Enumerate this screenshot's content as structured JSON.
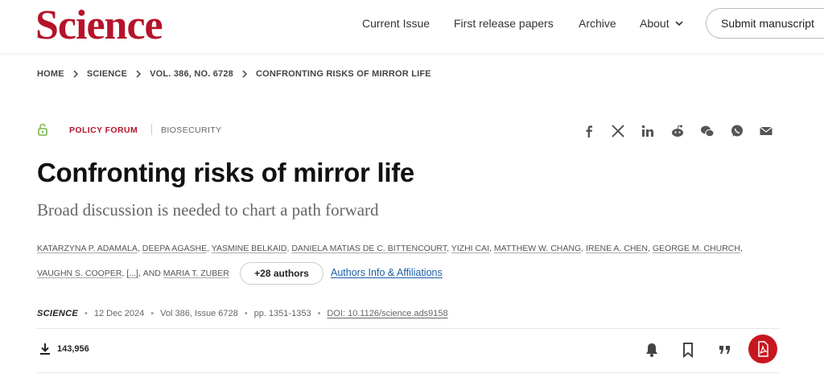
{
  "header": {
    "logo": "Science",
    "nav": [
      {
        "label": "Current Issue"
      },
      {
        "label": "First release papers"
      },
      {
        "label": "Archive"
      },
      {
        "label": "About"
      }
    ],
    "submit_label": "Submit manuscript"
  },
  "breadcrumb": [
    "HOME",
    "SCIENCE",
    "VOL. 386, NO. 6728",
    "CONFRONTING RISKS OF MIRROR LIFE"
  ],
  "article": {
    "section": "POLICY FORUM",
    "subject": "BIOSECURITY",
    "title": "Confronting risks of mirror life",
    "subtitle": "Broad discussion is needed to chart a path forward",
    "authors_line1": [
      "KATARZYNA P. ADAMALA",
      "DEEPA AGASHE",
      "YASMINE BELKAID",
      "DANIELA MATIAS DE C. BITTENCOURT",
      "YIZHI CAI",
      "MATTHEW W. CHANG",
      "IRENE A. CHEN",
      "GEORGE M. CHURCH"
    ],
    "authors_line2_first": "VAUGHN S. COOPER",
    "authors_ellipsis": "[...]",
    "authors_and": "AND",
    "authors_last": "MARIA T. ZUBER",
    "more_authors_label": "+28 authors",
    "affiliations_label": "Authors Info & Affiliations",
    "journal": "SCIENCE",
    "date": "12 Dec 2024",
    "volume": "Vol 386, Issue 6728",
    "pages": "pp. 1351-1353",
    "doi": "DOI: 10.1126/science.ads9158",
    "downloads": "143,956"
  },
  "share_icons": [
    "facebook-icon",
    "x-icon",
    "linkedin-icon",
    "reddit-icon",
    "wechat-icon",
    "whatsapp-icon",
    "email-icon"
  ],
  "action_icons": [
    "bell-icon",
    "bookmark-icon",
    "quote-icon",
    "pdf-icon"
  ],
  "colors": {
    "brand": "#b5132a",
    "link": "#1a5ea8",
    "pdf": "#c8161e"
  }
}
